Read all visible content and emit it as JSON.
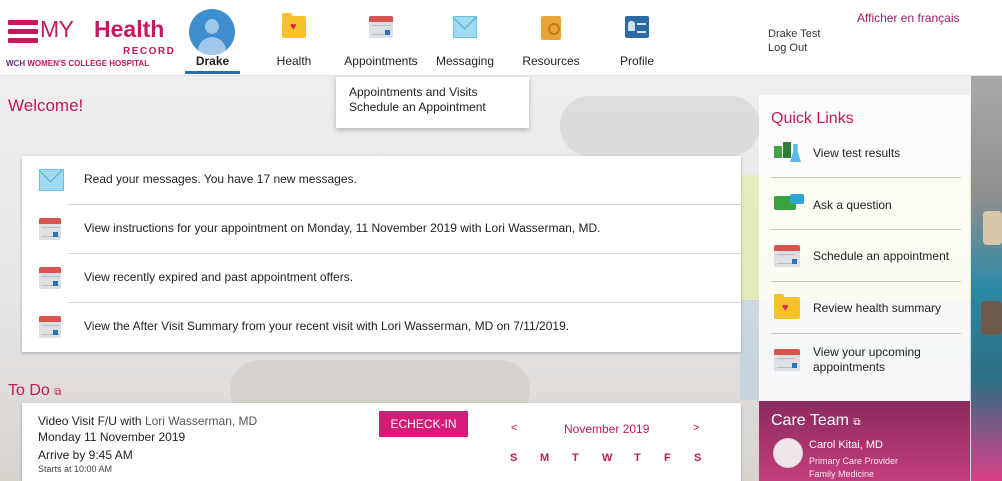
{
  "header": {
    "logo": {
      "my": "MY",
      "health": "Health",
      "record": "RECORD",
      "wch_abbr": "WCH",
      "hospital": "WOMEN'S COLLEGE HOSPITAL"
    },
    "nav": [
      {
        "label": "Drake",
        "icon": "user-avatar-icon"
      },
      {
        "label": "Health",
        "icon": "health-folder-icon"
      },
      {
        "label": "Appointments",
        "icon": "calendar-icon"
      },
      {
        "label": "Messaging",
        "icon": "envelope-icon"
      },
      {
        "label": "Resources",
        "icon": "book-icon"
      },
      {
        "label": "Profile",
        "icon": "profile-card-icon"
      }
    ],
    "user_name": "Drake Test",
    "logout_label": "Log Out",
    "language_link": "Afficher en français"
  },
  "dropdown": {
    "items": [
      "Appointments and Visits",
      "Schedule an Appointment"
    ]
  },
  "welcome": {
    "title": "Welcome!",
    "messages": [
      {
        "text": "Read your messages. You have 17 new messages.",
        "icon": "envelope-icon"
      },
      {
        "text": "View instructions for your appointment on Monday, 11 November 2019 with Lori Wasserman, MD.",
        "icon": "calendar-icon"
      },
      {
        "text": "View recently expired and past appointment offers.",
        "icon": "calendar-icon"
      },
      {
        "text": "View the After Visit Summary from your recent visit with Lori Wasserman, MD on 7/11/2019.",
        "icon": "calendar-icon"
      }
    ]
  },
  "todo": {
    "title": "To Do",
    "visit_type": "Video Visit F/U with",
    "doctor": "Lori Wasserman, MD",
    "date": "Monday 11 November 2019",
    "arrive": "Arrive by 9:45 AM",
    "starts": "Starts at 10:00 AM",
    "echeck_label": "ECHECK-IN",
    "calendar": {
      "prev": "<",
      "month": "November 2019",
      "next": ">",
      "weekdays": [
        "S",
        "M",
        "T",
        "W",
        "T",
        "F",
        "S"
      ]
    }
  },
  "quick_links": {
    "title": "Quick Links",
    "items": [
      {
        "label": "View test results",
        "icon": "test-results-icon"
      },
      {
        "label": "Ask a question",
        "icon": "chat-bubbles-icon"
      },
      {
        "label": "Schedule an appointment",
        "icon": "calendar-icon"
      },
      {
        "label": "Review health summary",
        "icon": "health-folder-icon"
      },
      {
        "label": "View your upcoming appointments",
        "icon": "calendar-icon"
      }
    ]
  },
  "care_team": {
    "title": "Care Team",
    "member": {
      "name": "Carol Kitai, MD",
      "role": "Primary Care Provider",
      "department": "Family Medicine"
    }
  },
  "colors": {
    "accent": "#c2185b",
    "button": "#d81b78",
    "nav_underline": "#2d6ca8"
  }
}
